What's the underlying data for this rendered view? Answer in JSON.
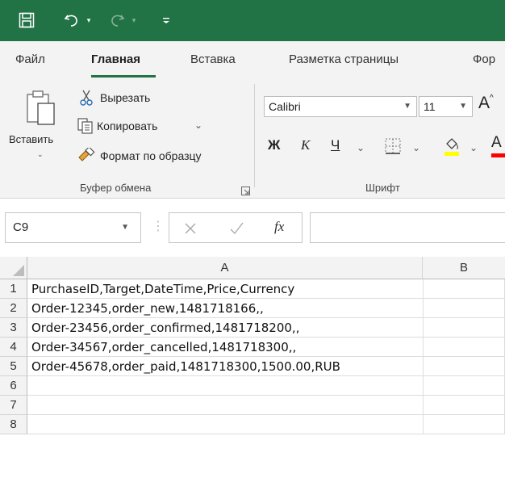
{
  "qat": {
    "save_icon": "save-icon",
    "undo_icon": "undo-icon",
    "redo_icon": "redo-icon",
    "customize_icon": "customize-qat-icon"
  },
  "tabs": [
    {
      "label": "Файл"
    },
    {
      "label": "Главная"
    },
    {
      "label": "Вставка"
    },
    {
      "label": "Разметка страницы"
    },
    {
      "label": "Фор"
    }
  ],
  "clipboard": {
    "paste_label": "Вставить",
    "cut_label": "Вырезать",
    "copy_label": "Копировать",
    "format_painter_label": "Формат по образцу",
    "group_label": "Буфер обмена"
  },
  "font": {
    "family": "Calibri",
    "size": "11",
    "grow_label": "A",
    "bold_label": "Ж",
    "italic_label": "К",
    "underline_label": "Ч",
    "color_label": "A",
    "group_label": "Шрифт",
    "highlight_color": "#FFFF00",
    "font_color": "#FF0000"
  },
  "formula_bar": {
    "name_box": "C9",
    "fx_label": "fx",
    "value": ""
  },
  "grid": {
    "columns": [
      "A",
      "B"
    ],
    "rows": [
      {
        "num": "1",
        "a": "PurchaseID,Target,DateTime,Price,Currency",
        "b": ""
      },
      {
        "num": "2",
        "a": "Order-12345,order_new,1481718166,,",
        "b": ""
      },
      {
        "num": "3",
        "a": "Order-23456,order_confirmed,1481718200,,",
        "b": ""
      },
      {
        "num": "4",
        "a": "Order-34567,order_cancelled,1481718300,,",
        "b": ""
      },
      {
        "num": "5",
        "a": "Order-45678,order_paid,1481718300,1500.00,RUB",
        "b": ""
      },
      {
        "num": "6",
        "a": "",
        "b": ""
      },
      {
        "num": "7",
        "a": "",
        "b": ""
      },
      {
        "num": "8",
        "a": "",
        "b": ""
      }
    ]
  },
  "colors": {
    "titlebar": "#217346",
    "accent": "#217346"
  }
}
